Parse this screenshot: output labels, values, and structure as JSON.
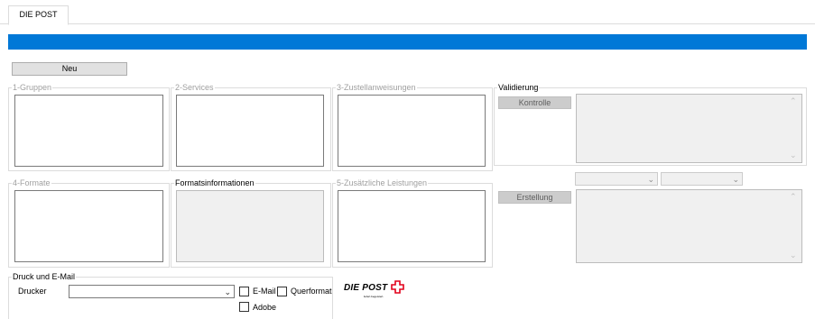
{
  "tab": {
    "label": "DIE POST"
  },
  "toolbar": {
    "new_label": "Neu"
  },
  "groups": {
    "gruppen": "1-Gruppen",
    "services": "2-Services",
    "zustell": "3-Zustellanweisungen",
    "formate": "4-Formate",
    "formatinfo": "Formatsinformationen",
    "zusatz": "5-Zusätzliche Leistungen",
    "validierung": "Validierung",
    "druck": "Druck und E-Mail"
  },
  "validation": {
    "kontrolle_label": "Kontrolle",
    "erstellung_label": "Erstellung"
  },
  "print": {
    "drucker_label": "Drucker",
    "email_label": "E-Mail",
    "querformat_label": "Querformat",
    "adobe_label": "Adobe"
  },
  "logo": {
    "brand": "DIE POST",
    "tagline": "liefert.begeistert."
  },
  "colors": {
    "accent_bar": "#0078d7",
    "logo_red": "#e2001a"
  }
}
